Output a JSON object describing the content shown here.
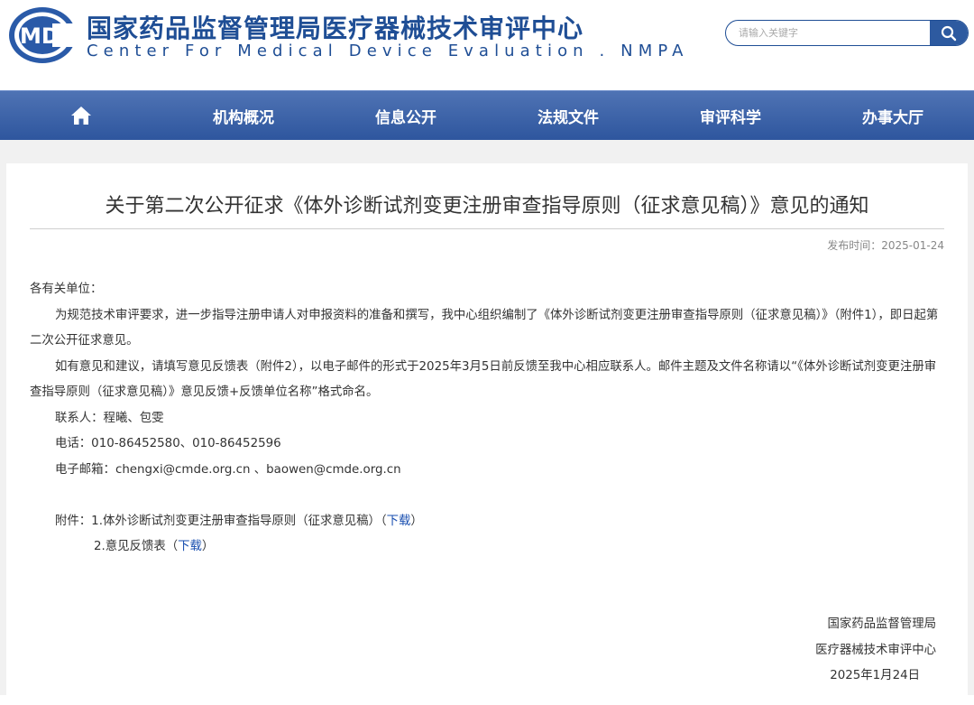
{
  "header": {
    "org_name_cn": "国家药品监督管理局医疗器械技术审评中心",
    "org_name_en": "Center For Medical Device Evaluation . NMPA",
    "logo_text": "MDE",
    "logo_initial": "C",
    "search_placeholder": "请输入关键字",
    "brand_color": "#1f4e95"
  },
  "nav": {
    "home_icon": "home-icon",
    "items": [
      "机构概况",
      "信息公开",
      "法规文件",
      "审评科学",
      "办事大厅"
    ]
  },
  "article": {
    "title": "关于第二次公开征求《体外诊断试剂变更注册审查指导原则（征求意见稿）》意见的通知",
    "pub_date": "发布时间：2025-01-24",
    "salutation": "各有关单位：",
    "para1": "为规范技术审评要求，进一步指导注册申请人对申报资料的准备和撰写，我中心组织编制了《体外诊断试剂变更注册审查指导原则（征求意见稿）》（附件1），即日起第二次公开征求意见。",
    "para2": "如有意见和建议，请填写意见反馈表（附件2），以电子邮件的形式于2025年3月5日前反馈至我中心相应联系人。邮件主题及文件名称请以“《体外诊断试剂变更注册审查指导原则（征求意见稿）》意见反馈+反馈单位名称”格式命名。",
    "contacts": "联系人：程曦、包雯",
    "phone": "电话：010-86452580、010-86452596",
    "email": "电子邮箱：chengxi@cmde.org.cn 、baowen@cmde.org.cn",
    "attachments": [
      {
        "prefix": "附件：",
        "label": "1.体外诊断试剂变更注册审查指导原则（征求意见稿）（",
        "link": "下载",
        "suffix": "）"
      },
      {
        "prefix": "",
        "label": "2.意见反馈表（",
        "link": "下载",
        "suffix": "）"
      }
    ],
    "signoff": {
      "line1": "国家药品监督管理局",
      "line2": "医疗器械技术审评中心",
      "date": "2025年1月24日"
    }
  }
}
